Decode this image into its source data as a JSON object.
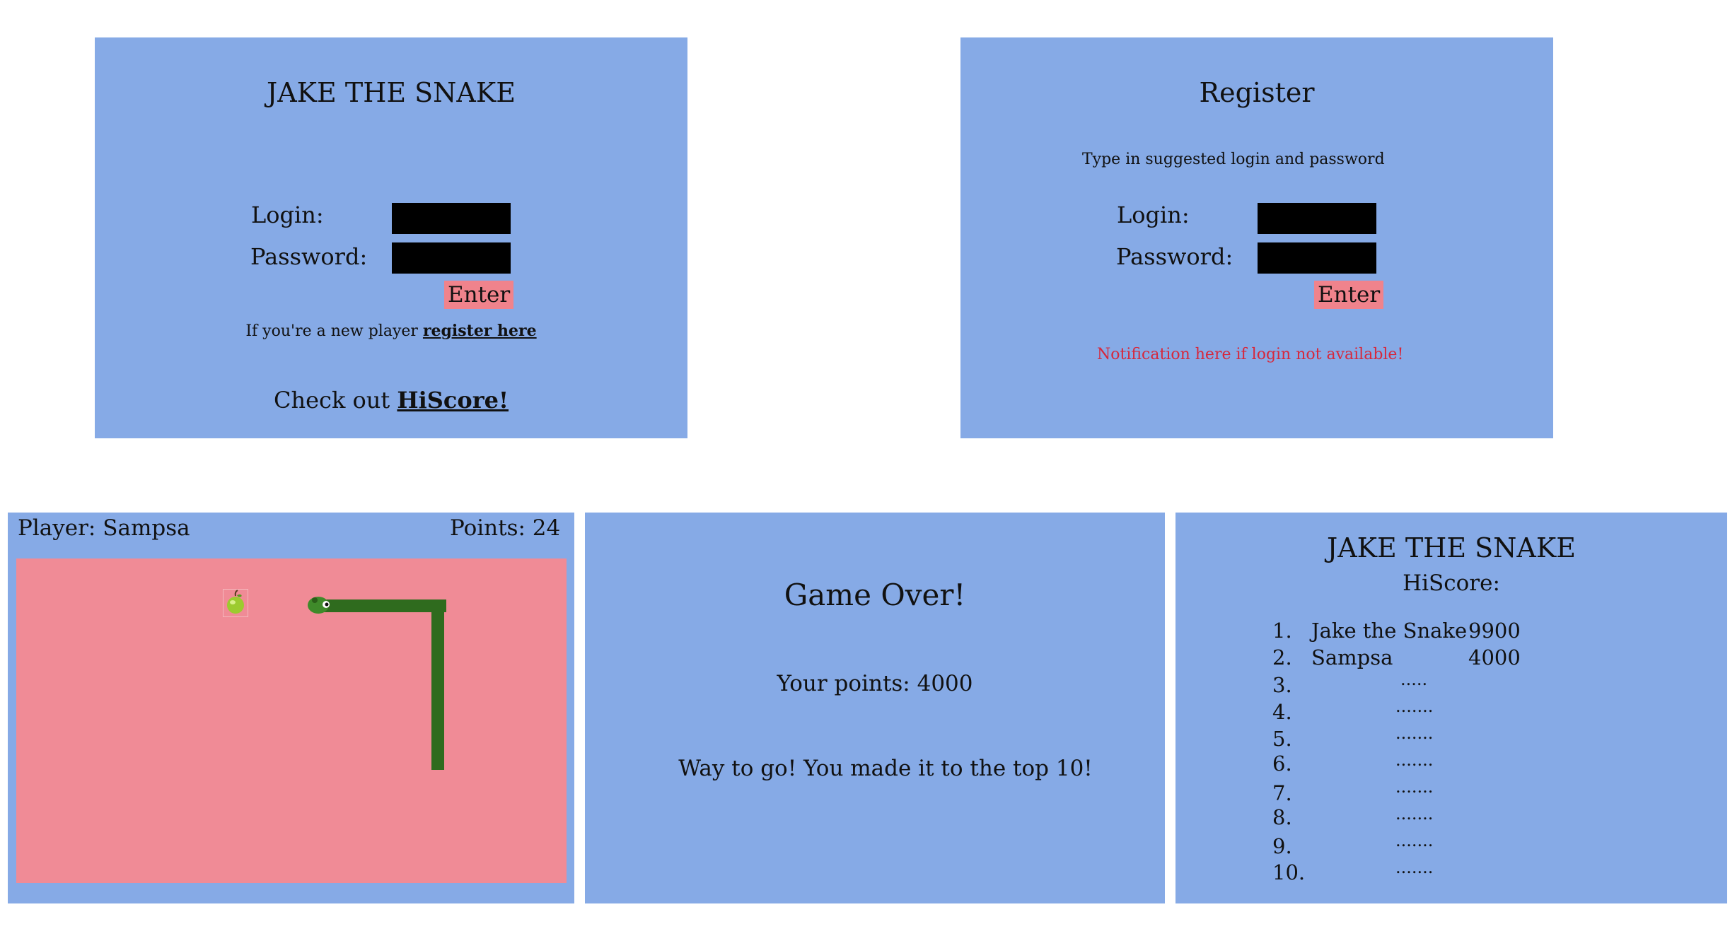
{
  "login_screen": {
    "title": "JAKE THE SNAKE",
    "login_label": "Login:",
    "password_label": "Password:",
    "enter_label": "Enter",
    "new_player_text": "If you're a new player",
    "register_link": "register here",
    "hiscore_prefix": "Check out",
    "hiscore_link": "HiScore!"
  },
  "register_screen": {
    "title": "Register",
    "instructions": "Type  in suggested login and password",
    "login_label": "Login:",
    "password_label": "Password:",
    "enter_label": "Enter",
    "notification": "Notification here if login not available!"
  },
  "game_screen": {
    "player": "Player: Sampsa",
    "points": "Points: 24",
    "apple_icon": "apple-icon",
    "snake_head_icon": "snake-head-icon"
  },
  "game_over_screen": {
    "title": "Game Over!",
    "points_text": "Your points: 4000",
    "message": "Way to go! You made it to the top 10!"
  },
  "hiscore_screen": {
    "title": "JAKE THE SNAKE",
    "subtitle": "HiScore:",
    "entries": [
      {
        "rank": "1.",
        "name": "Jake the Snake",
        "score": "9900"
      },
      {
        "rank": "2.",
        "name": "Sampsa",
        "score": "4000"
      },
      {
        "rank": "3.",
        "name": ".....",
        "score": ""
      },
      {
        "rank": "4.",
        "name": ".......",
        "score": ""
      },
      {
        "rank": "5.",
        "name": ".......",
        "score": ""
      },
      {
        "rank": "6.",
        "name": ".......",
        "score": ""
      },
      {
        "rank": "7.",
        "name": ".......",
        "score": ""
      },
      {
        "rank": "8.",
        "name": ".......",
        "score": ""
      },
      {
        "rank": "9.",
        "name": ".......",
        "score": ""
      },
      {
        "rank": "10.",
        "name": ".......",
        "score": ""
      }
    ]
  },
  "colors": {
    "panel": "#86aae6",
    "button": "#f0838c",
    "board": "#f08b96",
    "snake": "#2f6b1e",
    "notification": "#d6283c"
  }
}
